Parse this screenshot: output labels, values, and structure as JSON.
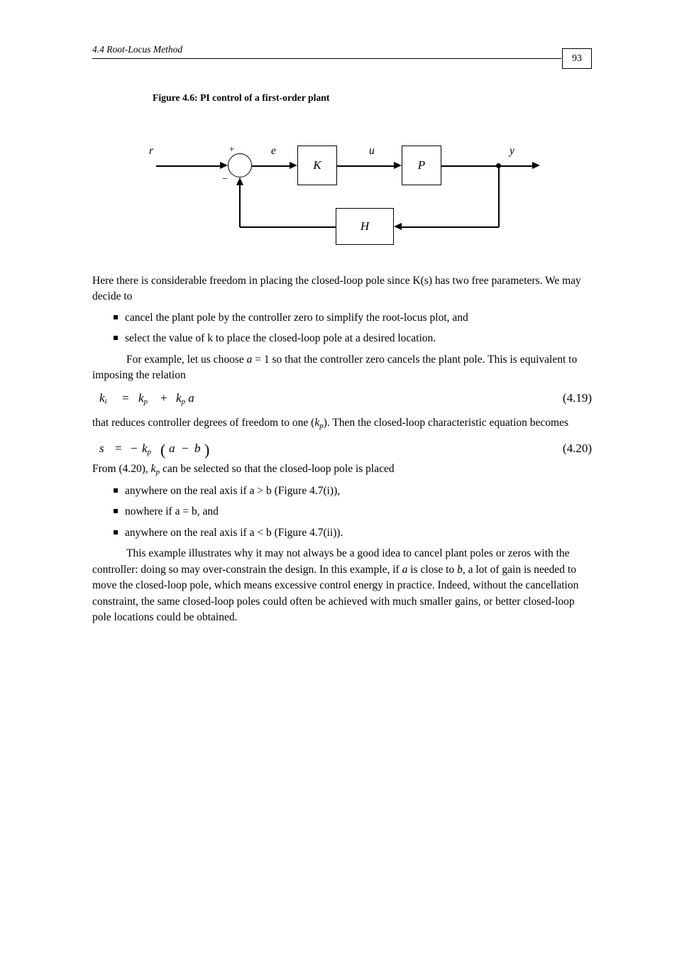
{
  "page_number": "93",
  "header": "4.4   Root-Locus Method",
  "fig6": {
    "caption": "Figure 4.6: PI control of a first-order plant",
    "labels": {
      "r": "r",
      "e": "e",
      "u": "u",
      "y": "y",
      "K": "K",
      "P": "P",
      "H": "H",
      "plus": "+",
      "minus": "−"
    }
  },
  "para1": "Here there is considerable freedom in placing the closed-loop pole since K(s) has two free parameters. We may decide to",
  "bullets1": [
    "cancel the plant pole by the controller zero to simplify the root-locus plot, and",
    "select the value of k to place the closed-loop pole at a desired location."
  ],
  "para2_prefix": "For example, let us choose ",
  "para2_a": "a",
  "para2_eq": " = 1",
  "para2_suffix": " so that the controller zero cancels the plant pole. This is equivalent to imposing the relation",
  "eq1": {
    "lhs": "k",
    "sub_lhs": "i",
    "eq": "=",
    "rhs1": "k",
    "sub_rhs1": "p",
    "plus": "+",
    "rhs2_coef": "k",
    "sub_rhs2": "p",
    "rhs2_rest": " a",
    "num": "(4.19)"
  },
  "para3_prefix": "that reduces controller degrees of freedom to one (",
  "para3_mid": "k",
  "para3_sub": "p",
  "para3_suffix": "). Then the closed-loop characteristic equation becomes",
  "eq2": {
    "lhs": "s",
    "eq": "=",
    "neg": "−",
    "k": "k",
    "sub_k": "p",
    "lpar": "(",
    "a": "a",
    "minus": "−",
    "b": "b",
    "rpar": ")",
    "num": "(4.20)"
  },
  "para4_prefix": "From (4.20), ",
  "para4_kp": "k",
  "para4_kp_sub": "p",
  "para4_suffix": " can be selected so that the closed-loop pole is placed",
  "bullets2": [
    "anywhere on the real axis if a > b (Figure 4.7(i)),",
    "nowhere if a = b, and",
    "anywhere on the real axis if a < b (Figure 4.7(ii))."
  ],
  "para5_prefix": "This example illustrates why it may not always be a good idea to cancel plant poles or zeros with the controller: doing so may over-constrain the design. In this example, if ",
  "para5_a": "a",
  "para5_mid": " is close to ",
  "para5_b": "b",
  "para5_suffix": ", a lot of gain is needed to move the closed-loop pole, which means excessive control energy in practice. Indeed, without the cancellation constraint, the same closed-loop poles could often be achieved with much smaller gains, or better closed-loop pole locations could be obtained."
}
